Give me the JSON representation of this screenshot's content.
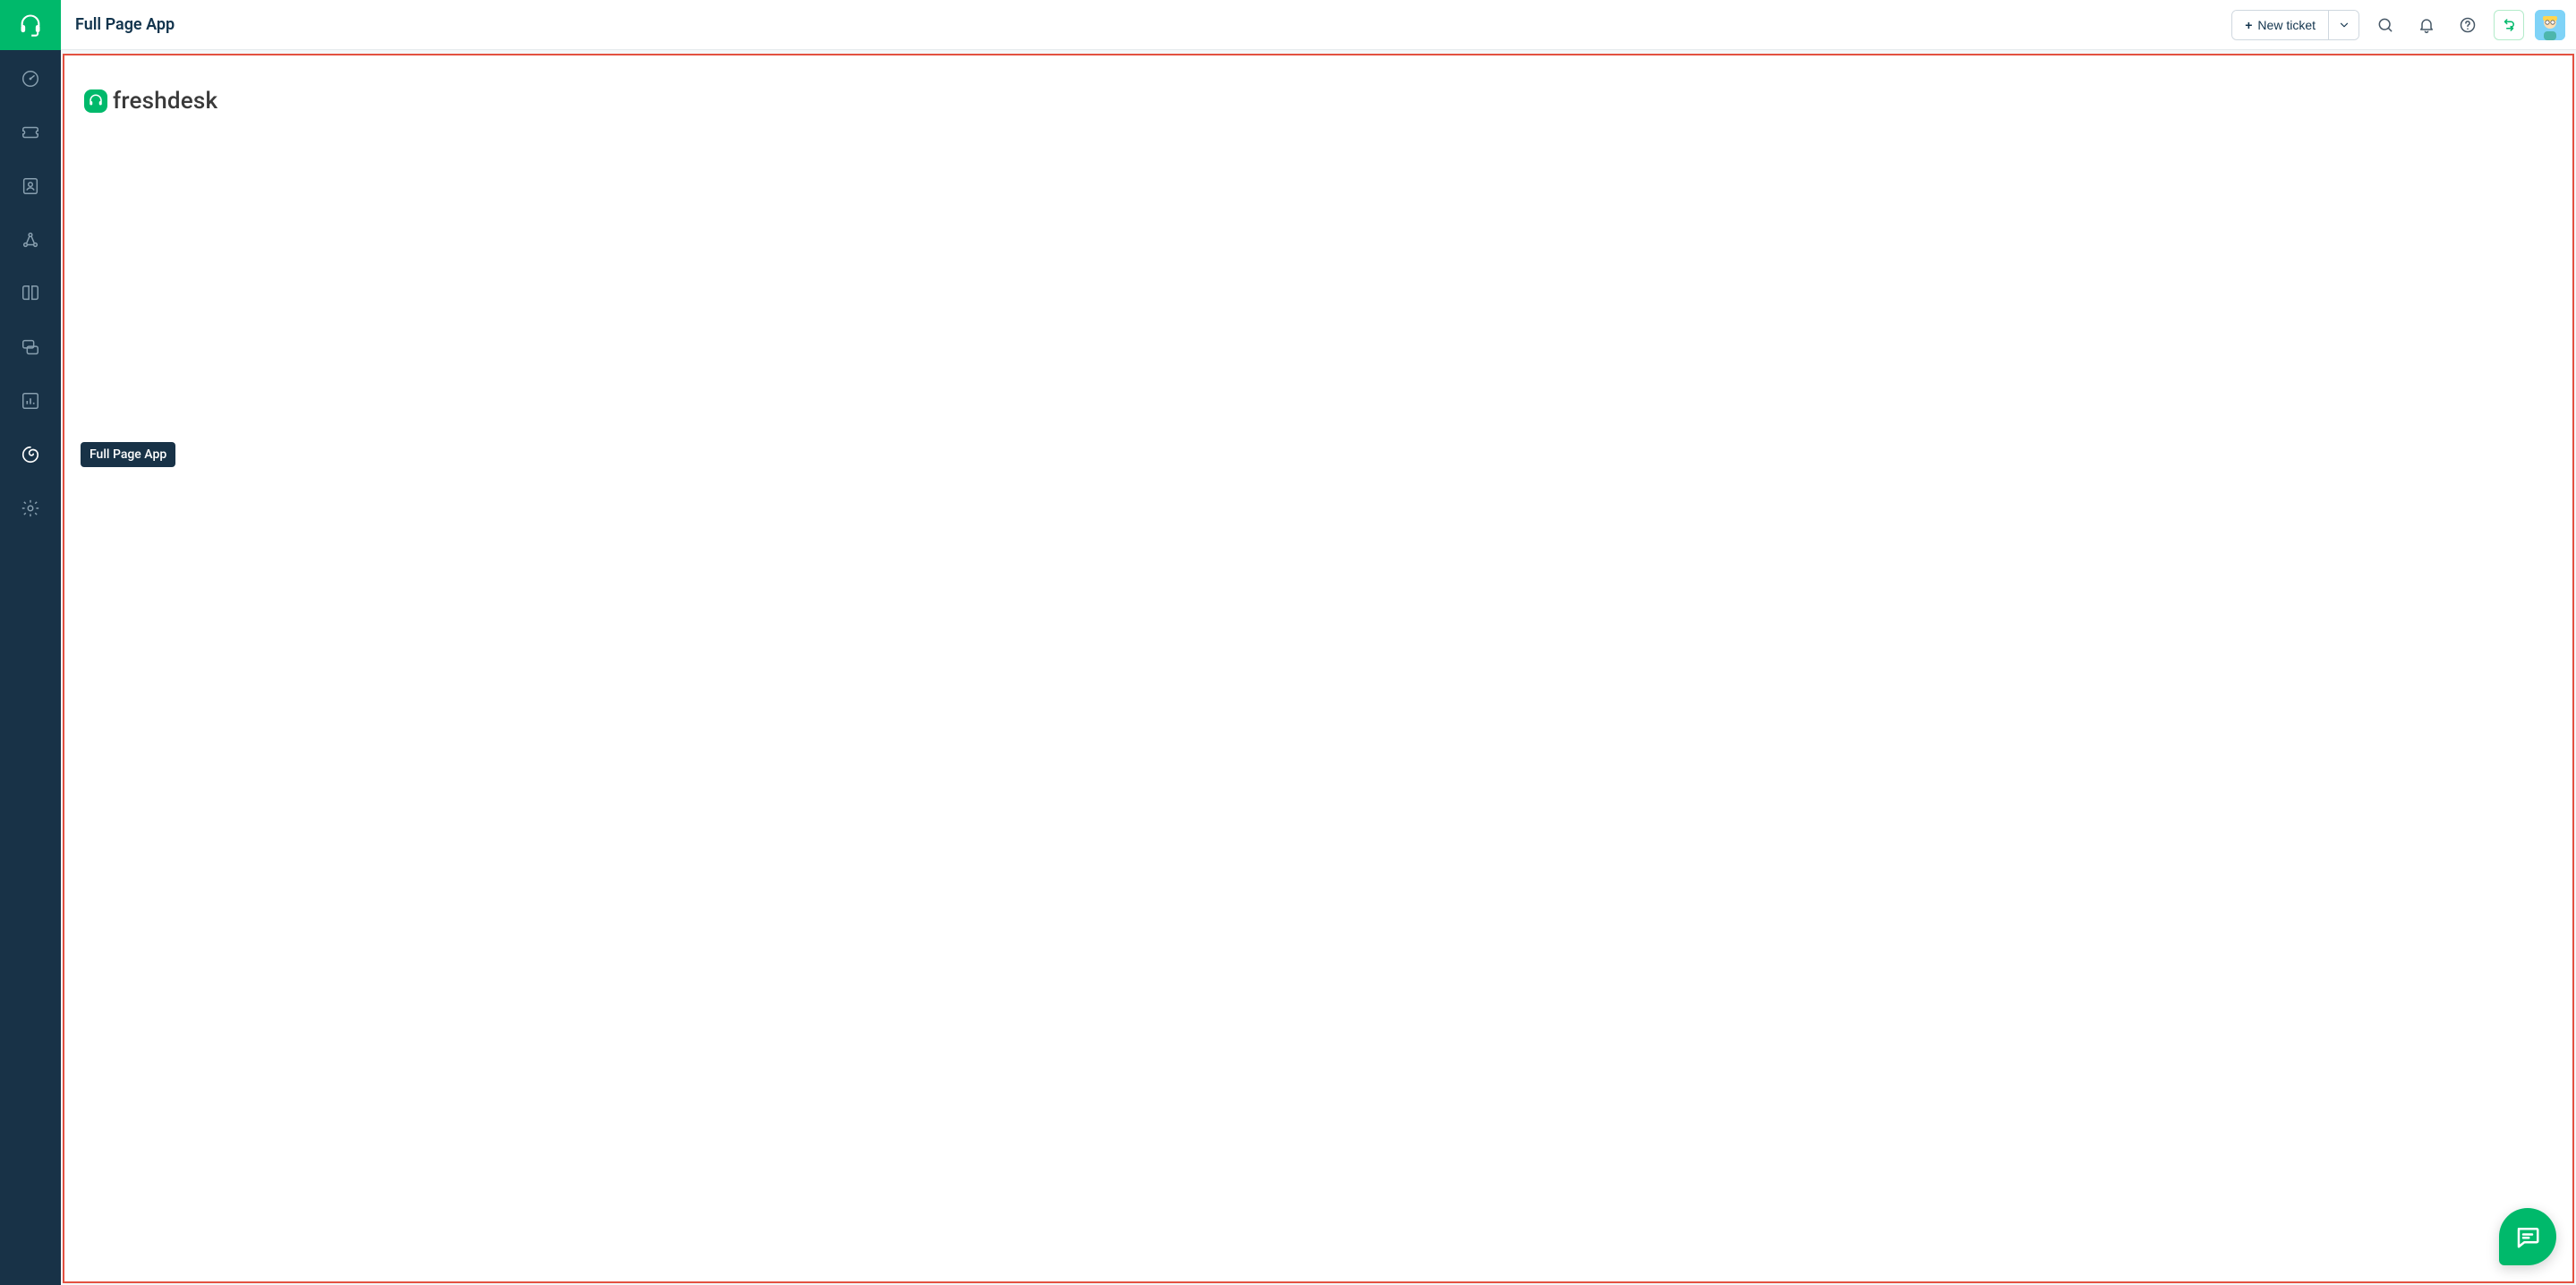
{
  "header": {
    "title": "Full Page App",
    "new_ticket_label": "New ticket"
  },
  "sidebar": {
    "items": [
      {
        "name": "dashboard",
        "icon": "gauge-icon"
      },
      {
        "name": "tickets",
        "icon": "ticket-icon"
      },
      {
        "name": "contacts",
        "icon": "contact-icon"
      },
      {
        "name": "social",
        "icon": "network-icon"
      },
      {
        "name": "solutions",
        "icon": "book-icon"
      },
      {
        "name": "forums",
        "icon": "chat-bubbles-icon"
      },
      {
        "name": "analytics",
        "icon": "bar-chart-icon"
      },
      {
        "name": "full-page-app",
        "icon": "swirl-icon",
        "active": true,
        "tooltip": "Full Page App"
      },
      {
        "name": "admin",
        "icon": "gear-icon"
      }
    ]
  },
  "content": {
    "app_brand": "freshdesk"
  },
  "tooltip_text": "Full Page App"
}
